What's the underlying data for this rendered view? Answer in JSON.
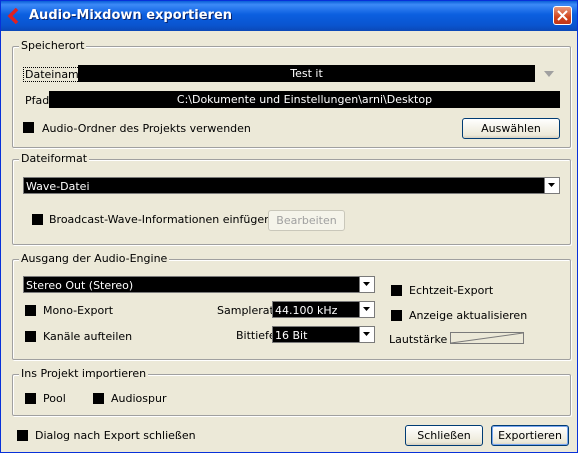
{
  "window": {
    "title": "Audio-Mixdown exportieren"
  },
  "speicherort": {
    "group_label": "Speicherort",
    "dateiname_label": "Dateiname",
    "dateiname_value": "Test it",
    "pfad_label": "Pfad",
    "pfad_value": "C:\\Dokumente und Einstellungen\\arni\\Desktop",
    "audio_ordner_label": "Audio-Ordner des Projekts verwenden",
    "auswaehlen_button": "Auswählen"
  },
  "dateiformat": {
    "group_label": "Dateiformat",
    "format_value": "Wave-Datei",
    "broadcast_label": "Broadcast-Wave-Informationen einfügen",
    "bearbeiten_button": "Bearbeiten"
  },
  "ausgang": {
    "group_label": "Ausgang der Audio-Engine",
    "output_value": "Stereo Out (Stereo)",
    "mono_export_label": "Mono-Export",
    "kanaele_label": "Kanäle aufteilen",
    "samplerate_label": "Samplerate",
    "samplerate_value": "44.100 kHz",
    "bittiefe_label": "Bittiefe",
    "bittiefe_value": "16 Bit",
    "echtzeit_label": "Echtzeit-Export",
    "anzeige_label": "Anzeige aktualisieren",
    "lautstaerke_label": "Lautstärke"
  },
  "import": {
    "group_label": "Ins Projekt importieren",
    "pool_label": "Pool",
    "audiospur_label": "Audiospur"
  },
  "footer": {
    "dialog_close_label": "Dialog nach Export schließen",
    "schliessen_button": "Schließen",
    "exportieren_button": "Exportieren"
  }
}
